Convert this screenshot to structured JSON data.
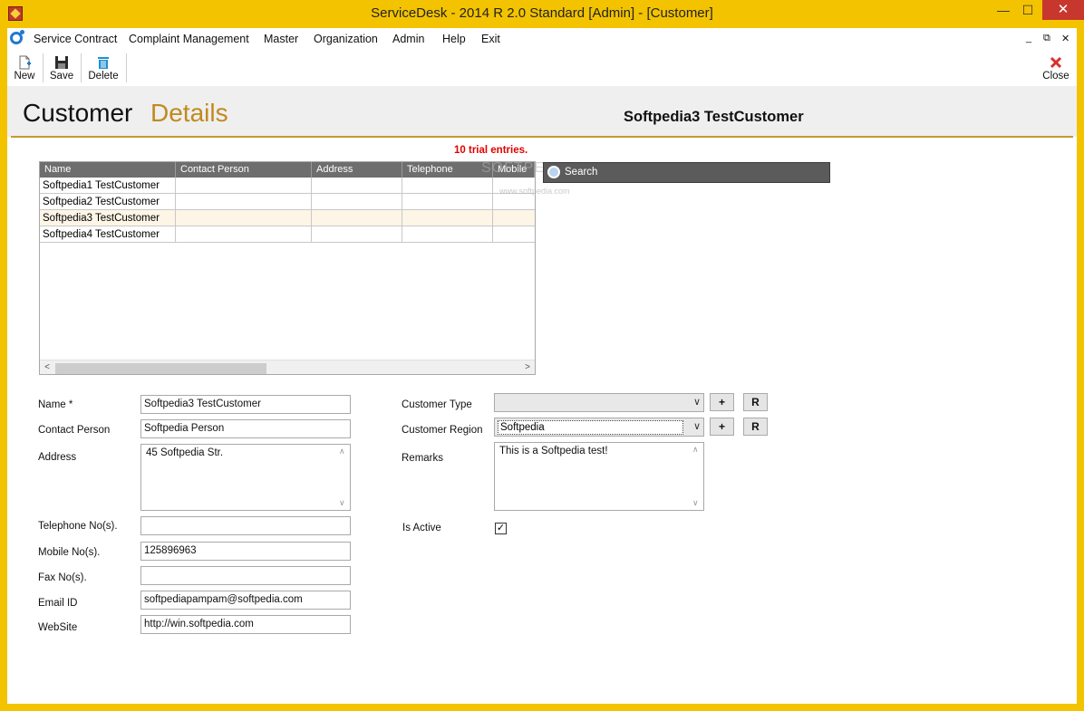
{
  "window": {
    "title": "ServiceDesk - 2014 R 2.0 Standard [Admin] - [Customer]",
    "minimize": "—",
    "maximize": "☐",
    "close": "✕"
  },
  "menu": {
    "items": [
      "Service Contract",
      "Complaint Management",
      "Master",
      "Organization",
      "Admin",
      "Help",
      "Exit"
    ],
    "mdi_min": "_",
    "mdi_restore": "⧉",
    "mdi_close": "✕"
  },
  "toolbar": {
    "new_label": "New",
    "save_label": "Save",
    "delete_label": "Delete",
    "close_label": "Close"
  },
  "header": {
    "title_part1": "Customer",
    "title_part2": "Details",
    "selected_customer": "Softpedia3 TestCustomer"
  },
  "trial_notice": "10 trial entries.",
  "grid": {
    "columns": [
      "Name",
      "Contact Person",
      "Address",
      "Telephone",
      "Mobile"
    ],
    "rows": [
      [
        "Softpedia1 TestCustomer",
        "",
        "",
        "",
        ""
      ],
      [
        "Softpedia2 TestCustomer",
        "",
        "",
        "",
        ""
      ],
      [
        "Softpedia3 TestCustomer",
        "",
        "",
        "",
        ""
      ],
      [
        "Softpedia4 TestCustomer",
        "",
        "",
        "",
        ""
      ]
    ],
    "selected_row": 2,
    "scroll_left": "<",
    "scroll_right": ">"
  },
  "search": {
    "placeholder": "Search"
  },
  "watermark": "SOFTPEDIA",
  "watermark_url": "www.softpedia.com",
  "form": {
    "name_label": "Name  *",
    "name_value": "Softpedia3 TestCustomer",
    "contact_label": "Contact Person",
    "contact_value": "Softpedia Person",
    "address_label": "Address",
    "address_value": "45 Softpedia Str.",
    "telephone_label": "Telephone No(s).",
    "telephone_value": "",
    "mobile_label": "Mobile No(s).",
    "mobile_value": "125896963",
    "fax_label": "Fax No(s).",
    "fax_value": "",
    "email_label": "Email ID",
    "email_value": "softpediapampam@softpedia.com",
    "website_label": "WebSite",
    "website_value": "http://win.softpedia.com",
    "customer_type_label": "Customer Type",
    "customer_type_value": "",
    "customer_region_label": "Customer Region",
    "customer_region_value": "Softpedia",
    "remarks_label": "Remarks",
    "remarks_value": "This is a Softpedia test!",
    "is_active_label": "Is Active",
    "is_active": true,
    "add_btn": "+",
    "refresh_btn": "R"
  },
  "colors": {
    "title_bar": "#f3c300",
    "accent_gold": "#c08a1e",
    "trial_red": "#e00000",
    "grid_header": "#6e6e6e",
    "selected_row": "#fdf5e6"
  }
}
